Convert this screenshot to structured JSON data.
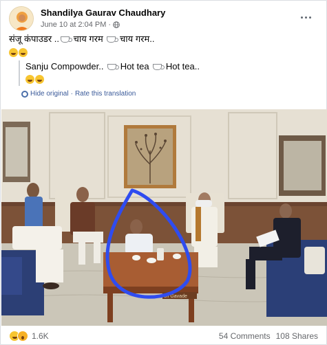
{
  "post": {
    "author": "Shandilya Gaurav Chaudhary",
    "timestamp": "June 10 at 2:04 PM",
    "privacy_icon": "globe-icon",
    "original_text_part1": "संजू कंपाउडर ..",
    "original_text_part2": " चाय गरम ",
    "original_text_part3": " चाय गरम..",
    "translated_text_part1": "Sanju Compowder.. ",
    "translated_text_part2": " Hot tea ",
    "translated_text_part3": " Hot tea..",
    "hide_original": "Hide original",
    "separator": "·",
    "rate_translation": "Rate this translation"
  },
  "photo": {
    "nameplate_text": "ch Gavade"
  },
  "footer": {
    "reaction_count": "1.6K",
    "comments": "54 Comments",
    "shares": "108 Shares"
  },
  "colors": {
    "link": "#385898",
    "secondary_text": "#65676b",
    "annotation_circle": "#2f4cf0"
  }
}
